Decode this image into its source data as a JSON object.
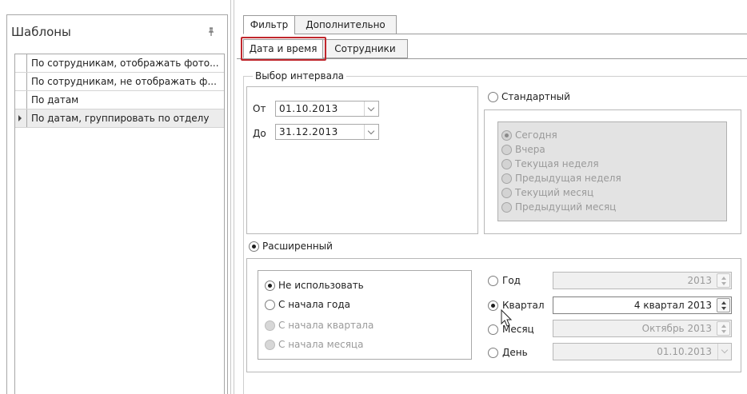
{
  "templates_panel": {
    "title": "Шаблоны",
    "items": [
      {
        "label": "По сотрудникам, отображать фото..."
      },
      {
        "label": "По сотрудникам, не отображать ф..."
      },
      {
        "label": "По датам"
      },
      {
        "label": "По датам, группировать по отделу",
        "selected": true
      }
    ]
  },
  "tabs": [
    {
      "label": "Фильтр",
      "active": true
    },
    {
      "label": "Дополнительно",
      "active": false
    }
  ],
  "sub_tabs": [
    {
      "label": "Дата и время",
      "active": true
    },
    {
      "label": "Сотрудники",
      "active": false
    }
  ],
  "interval": {
    "legend": "Выбор интервала",
    "from_label": "От",
    "from_value": "01.10.2013",
    "to_label": "До",
    "to_value": "31.12.2013"
  },
  "standard": {
    "label": "Стандартный",
    "selected": false,
    "options": [
      {
        "label": "Сегодня",
        "checked": true
      },
      {
        "label": "Вчера",
        "checked": false
      },
      {
        "label": "Текущая неделя",
        "checked": false
      },
      {
        "label": "Предыдущая неделя",
        "checked": false
      },
      {
        "label": "Текущий месяц",
        "checked": false
      },
      {
        "label": "Предыдущий месяц",
        "checked": false
      }
    ]
  },
  "extended": {
    "label": "Расширенный",
    "selected": true,
    "modes": [
      {
        "label": "Не использовать",
        "checked": true,
        "enabled": true
      },
      {
        "label": "С начала года",
        "checked": false,
        "enabled": true
      },
      {
        "label": "С начала квартала",
        "checked": false,
        "enabled": false
      },
      {
        "label": "С начала месяца",
        "checked": false,
        "enabled": false
      }
    ],
    "periods": [
      {
        "label": "Год",
        "value": "2013",
        "checked": false,
        "enabled": false
      },
      {
        "label": "Квартал",
        "value": "4 квартал 2013",
        "checked": true,
        "enabled": true
      },
      {
        "label": "Месяц",
        "value": "Октябрь 2013",
        "checked": false,
        "enabled": false
      },
      {
        "label": "День",
        "value": "01.10.2013",
        "checked": false,
        "enabled": false
      }
    ]
  },
  "colors": {
    "highlight_border": "#c0272d",
    "disabled_text": "#9a9a9a",
    "panel_border": "#a7a7a7"
  }
}
